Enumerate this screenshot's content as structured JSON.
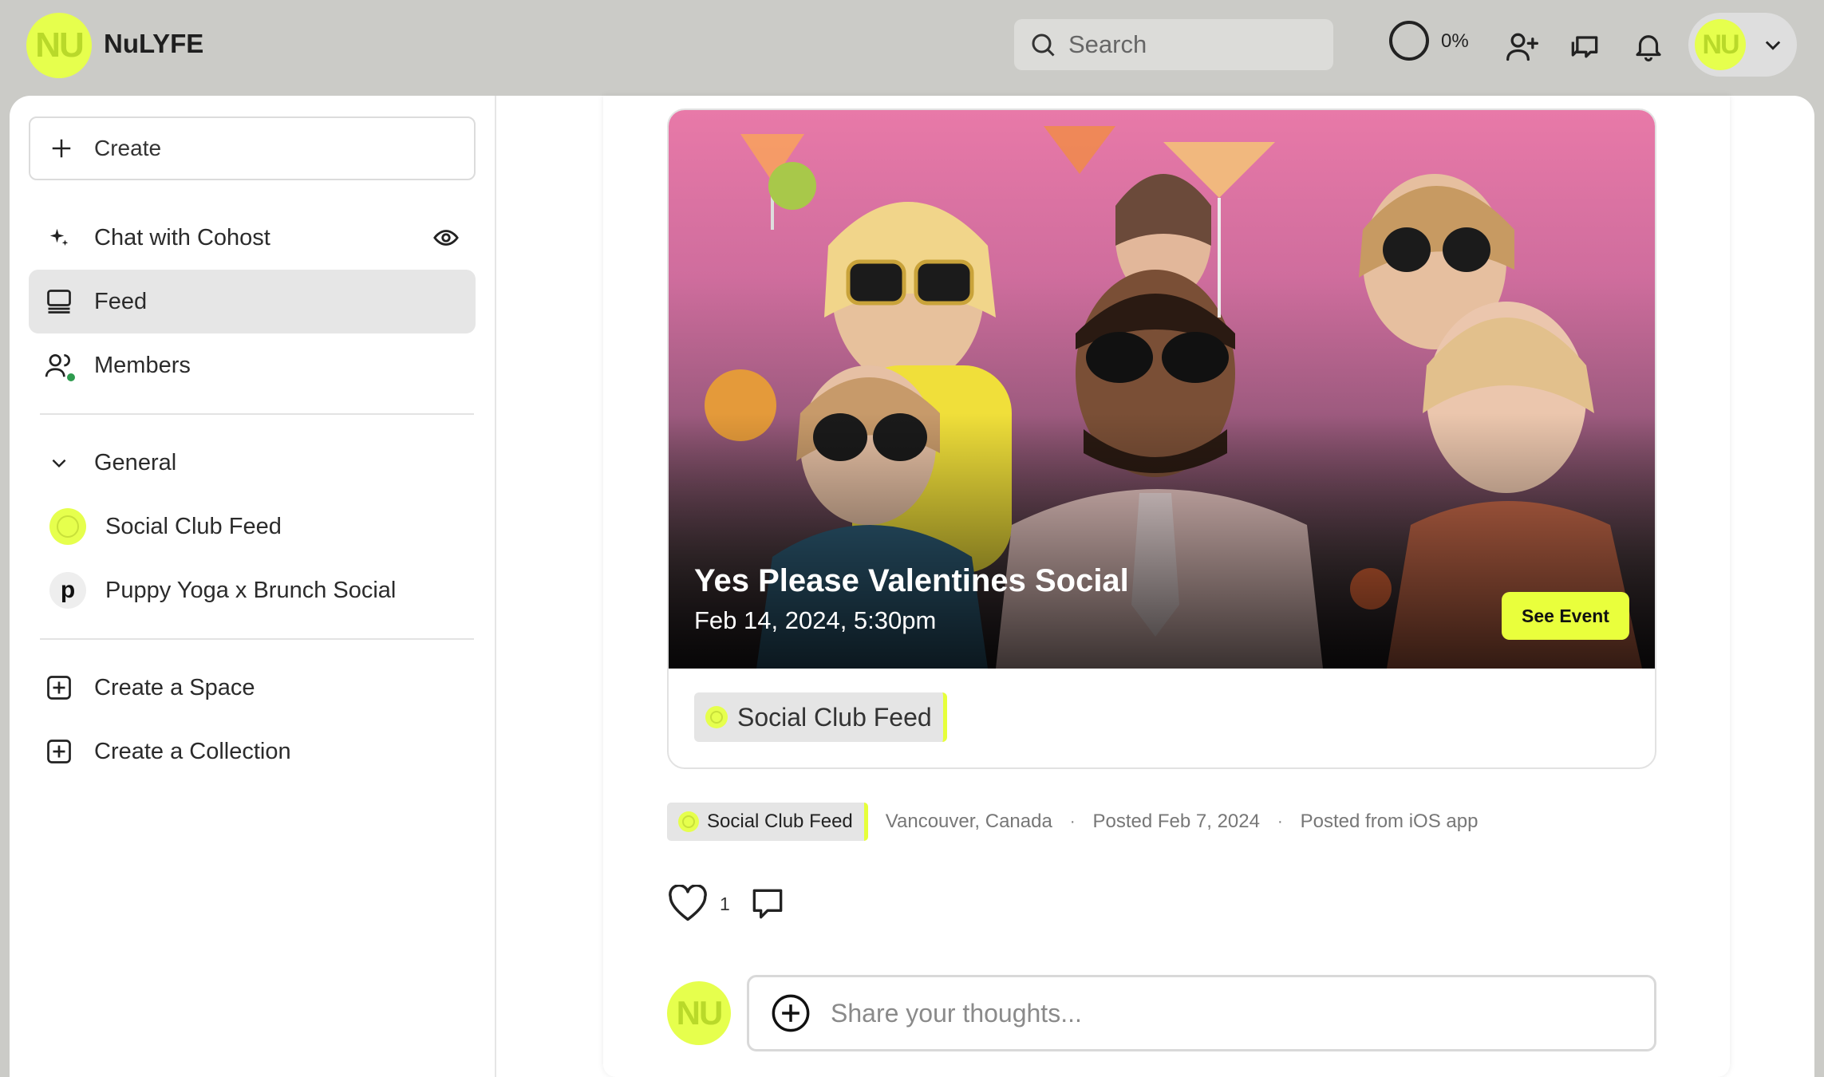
{
  "header": {
    "logo_text": "NU",
    "app_name": "NuLYFE",
    "search_placeholder": "Search",
    "progress_text": "0%",
    "profile_avatar_text": "NU"
  },
  "sidebar": {
    "create_label": "Create",
    "chat_label": "Chat with Cohost",
    "feed_label": "Feed",
    "members_label": "Members",
    "group_label": "General",
    "spaces": [
      {
        "label": "Social Club Feed"
      },
      {
        "label": "Puppy Yoga x Brunch Social",
        "initial": "p"
      }
    ],
    "create_space_label": "Create a Space",
    "create_collection_label": "Create a Collection"
  },
  "post": {
    "event": {
      "title": "Yes Please Valentines Social",
      "date": "Feb 14, 2024, 5:30pm",
      "button_label": "See Event",
      "space_tag": "Social Club Feed"
    },
    "meta": {
      "space_tag": "Social Club Feed",
      "location": "Vancouver, Canada",
      "posted": "Posted Feb 7, 2024",
      "source": "Posted from iOS app",
      "separator": "·"
    },
    "like_count": "1",
    "compose": {
      "avatar_text": "NU",
      "placeholder": "Share your thoughts..."
    }
  },
  "colors": {
    "accent": "#e6ff4d",
    "background": "#cbcbc7",
    "active_nav": "#e6e6e6",
    "online_dot": "#2e9b4e"
  }
}
